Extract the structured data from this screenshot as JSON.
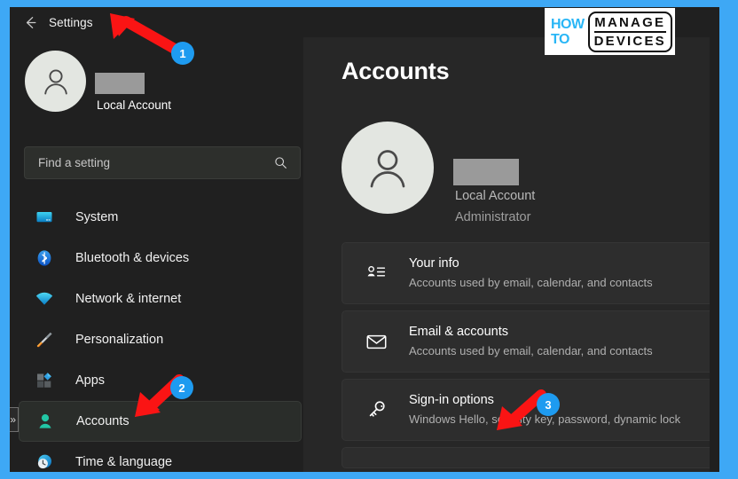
{
  "window": {
    "title": "Settings",
    "back_icon": "back-arrow-icon"
  },
  "sidebar": {
    "account": {
      "name_redacted": "",
      "account_type": "Local Account",
      "avatar_icon": "person-avatar-icon"
    },
    "search": {
      "placeholder": "Find a setting",
      "value": "Find a setting",
      "icon": "search-icon"
    },
    "items": [
      {
        "label": "System",
        "icon": "monitor-icon",
        "selected": false
      },
      {
        "label": "Bluetooth & devices",
        "icon": "bluetooth-icon",
        "selected": false
      },
      {
        "label": "Network & internet",
        "icon": "wifi-icon",
        "selected": false
      },
      {
        "label": "Personalization",
        "icon": "paintbrush-icon",
        "selected": false
      },
      {
        "label": "Apps",
        "icon": "apps-grid-icon",
        "selected": false
      },
      {
        "label": "Accounts",
        "icon": "person-icon",
        "selected": true
      },
      {
        "label": "Time & language",
        "icon": "clock-globe-icon",
        "selected": false
      }
    ],
    "expand_chevron": "»"
  },
  "main": {
    "page_title": "Accounts",
    "profile": {
      "name_redacted": "",
      "account_type": "Local Account",
      "role": "Administrator",
      "avatar_icon": "person-avatar-icon"
    },
    "cards": [
      {
        "title": "Your info",
        "subtitle": "Accounts used by email, calendar, and contacts",
        "icon": "person-list-icon"
      },
      {
        "title": "Email & accounts",
        "subtitle": "Accounts used by email, calendar, and contacts",
        "icon": "envelope-icon"
      },
      {
        "title": "Sign-in options",
        "subtitle": "Windows Hello, security key, password, dynamic lock",
        "icon": "key-icon"
      }
    ]
  },
  "watermark": {
    "line1": "HOW",
    "line2": "TO",
    "box_line1": "MANAGE",
    "box_line2": "DEVICES"
  },
  "annotations": [
    {
      "badge": "1",
      "target": "settings-title",
      "direction": "up-left"
    },
    {
      "badge": "2",
      "target": "sidebar-item-accounts",
      "direction": "down-left"
    },
    {
      "badge": "3",
      "target": "card-sign-in-options",
      "direction": "down-left"
    }
  ],
  "colors": {
    "frame_blue": "#3ea8f5",
    "accent_blue": "#4cc2ff",
    "badge_blue": "#1e9bf0",
    "arrow_red": "#fa1414",
    "window_bg": "#202020",
    "main_bg": "#272727",
    "card_bg": "#2d2d2d"
  }
}
